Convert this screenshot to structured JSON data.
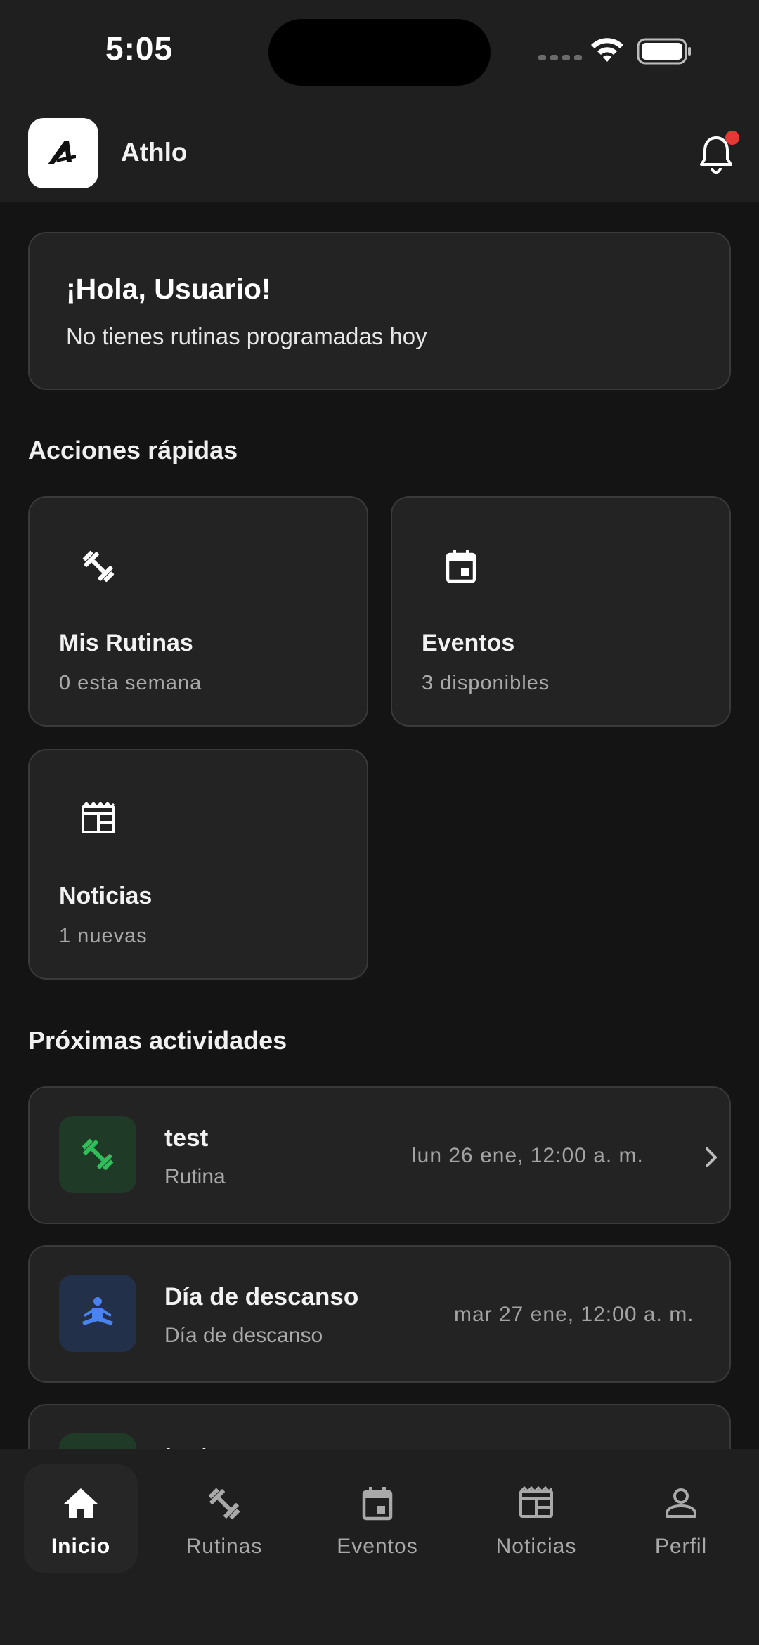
{
  "status_bar": {
    "time": "5:05"
  },
  "app": {
    "name": "Athlo",
    "logo_letter": "A"
  },
  "greeting": {
    "title": "¡Hola, Usuario!",
    "subtitle": "No tienes rutinas programadas hoy"
  },
  "quick_actions": {
    "title": "Acciones rápidas",
    "items": [
      {
        "icon": "dumbbell-icon",
        "title": "Mis Rutinas",
        "subtitle": "0 esta semana"
      },
      {
        "icon": "calendar-icon",
        "title": "Eventos",
        "subtitle": "3 disponibles"
      },
      {
        "icon": "newspaper-icon",
        "title": "Noticias",
        "subtitle": "1 nuevas"
      }
    ]
  },
  "upcoming": {
    "title": "Próximas actividades",
    "items": [
      {
        "icon": "dumbbell-icon",
        "title": "test",
        "subtitle": "Rutina",
        "date": "lun 26 ene, 12:00 a. m.",
        "accent": "#2fbf5a",
        "badge_bg": "#1f3a26"
      },
      {
        "icon": "meditation-icon",
        "title": "Día de descanso",
        "subtitle": "Día de descanso",
        "date": "mar 27 ene, 12:00 a. m.",
        "accent": "#4a82f0",
        "badge_bg": "#23304a"
      },
      {
        "icon": "dumbbell-icon",
        "title": "test",
        "subtitle": "",
        "date": "",
        "accent": "#2fbf5a",
        "badge_bg": "#1f3a26"
      }
    ]
  },
  "bottom_nav": {
    "items": [
      {
        "label": "Inicio",
        "icon": "home-icon",
        "active": true
      },
      {
        "label": "Rutinas",
        "icon": "dumbbell-icon",
        "active": false
      },
      {
        "label": "Eventos",
        "icon": "calendar-icon",
        "active": false
      },
      {
        "label": "Noticias",
        "icon": "newspaper-icon",
        "active": false
      },
      {
        "label": "Perfil",
        "icon": "person-icon",
        "active": false
      }
    ]
  },
  "colors": {
    "background": "#141414",
    "surface": "#232323",
    "border": "#3a3a3a",
    "notification_dot": "#e53935"
  }
}
